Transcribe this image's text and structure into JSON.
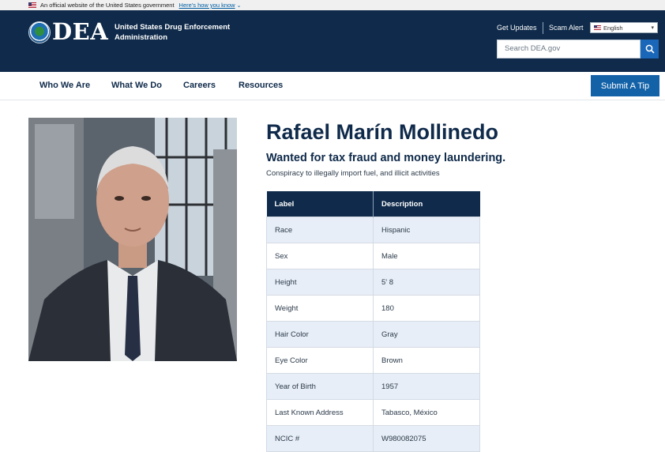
{
  "gov_banner": {
    "text": "An official website of the United States government",
    "link": "Here's how you know"
  },
  "header": {
    "logo": "DEA",
    "agency_name": "United States Drug Enforcement Administration",
    "get_updates": "Get Updates",
    "scam_alert": "Scam Alert",
    "language": "English",
    "search_placeholder": "Search DEA.gov"
  },
  "nav": {
    "items": [
      "Who We Are",
      "What We Do",
      "Careers",
      "Resources"
    ],
    "tip_button": "Submit A Tip"
  },
  "profile": {
    "name": "Rafael Marín Mollinedo",
    "wanted_for": "Wanted for tax fraud and money laundering.",
    "charges": "Conspiracy to illegally import fuel, and illicit activities",
    "table": {
      "headers": [
        "Label",
        "Description"
      ],
      "rows": [
        [
          "Race",
          "Hispanic"
        ],
        [
          "Sex",
          "Male"
        ],
        [
          "Height",
          "5' 8"
        ],
        [
          "Weight",
          "180"
        ],
        [
          "Hair Color",
          "Gray"
        ],
        [
          "Eye Color",
          "Brown"
        ],
        [
          "Year of Birth",
          "1957"
        ],
        [
          "Last Known Address",
          "Tabasco, México"
        ],
        [
          "NCIC #",
          "W980082075"
        ]
      ]
    }
  },
  "colors": {
    "header_bg": "#0f2a4a",
    "accent_blue": "#1362a8",
    "row_alt": "#e7eef7"
  }
}
